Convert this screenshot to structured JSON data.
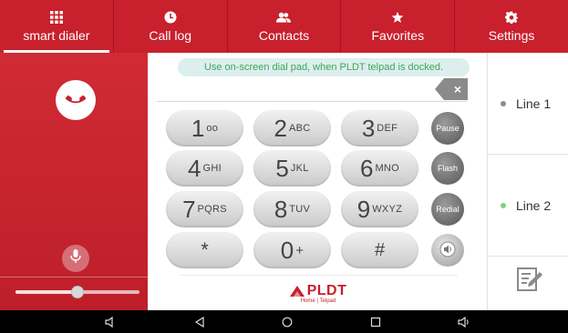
{
  "nav": {
    "tabs": [
      {
        "label": "smart dialer",
        "icon": "grid-icon"
      },
      {
        "label": "Call log",
        "icon": "clock-icon"
      },
      {
        "label": "Contacts",
        "icon": "people-icon"
      },
      {
        "label": "Favorites",
        "icon": "star-icon"
      },
      {
        "label": "Settings",
        "icon": "gear-icon"
      }
    ],
    "active_tab": "smart dialer"
  },
  "left_panel": {
    "volume_level": 0.5
  },
  "dialer": {
    "hint": "Use on-screen dial pad, when PLDT telpad is docked.",
    "keys": [
      {
        "digit": "1",
        "letters": "ᴏᴏ"
      },
      {
        "digit": "2",
        "letters": "ABC"
      },
      {
        "digit": "3",
        "letters": "DEF"
      },
      {
        "digit": "4",
        "letters": "GHI"
      },
      {
        "digit": "5",
        "letters": "JKL"
      },
      {
        "digit": "6",
        "letters": "MNO"
      },
      {
        "digit": "7",
        "letters": "PQRS"
      },
      {
        "digit": "8",
        "letters": "TUV"
      },
      {
        "digit": "9",
        "letters": "WXYZ"
      },
      {
        "digit": "*",
        "letters": ""
      },
      {
        "digit": "0",
        "letters": "+"
      },
      {
        "digit": "#",
        "letters": ""
      }
    ],
    "function_buttons": {
      "pause": "Pause",
      "flash": "Flash",
      "redial": "Redial"
    },
    "backspace_glyph": "×"
  },
  "brand": {
    "name": "PLDT",
    "sub": "Home | Telpad",
    "color": "#c8202c"
  },
  "lines": [
    {
      "label": "Line 1",
      "status_color": "#8c8c8c"
    },
    {
      "label": "Line 2",
      "status_color": "#7cd37c"
    }
  ],
  "colors": {
    "accent": "#c8202c",
    "hint_text": "#3ea65a"
  }
}
